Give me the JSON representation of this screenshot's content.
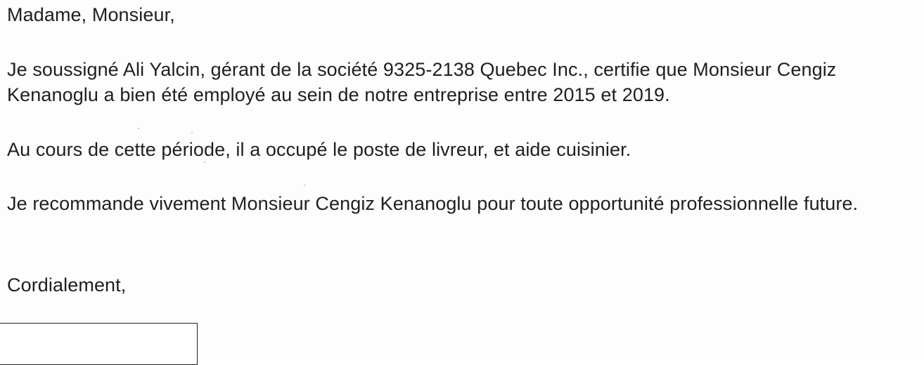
{
  "letter": {
    "salutation": "Madame, Monsieur,",
    "paragraphs": [
      "Je soussigné Ali Yalcin, gérant de la société 9325-2138 Quebec Inc., certifie que Monsieur Cengiz Kenanoglu a bien été employé au sein de notre entreprise entre 2015 et 2019.",
      "Au cours de cette période, il a occupé le poste de livreur, et aide cuisinier.",
      "Je recommande vivement Monsieur Cengiz Kenanoglu pour toute opportunité professionnelle future."
    ],
    "closing": "Cordialement,"
  }
}
